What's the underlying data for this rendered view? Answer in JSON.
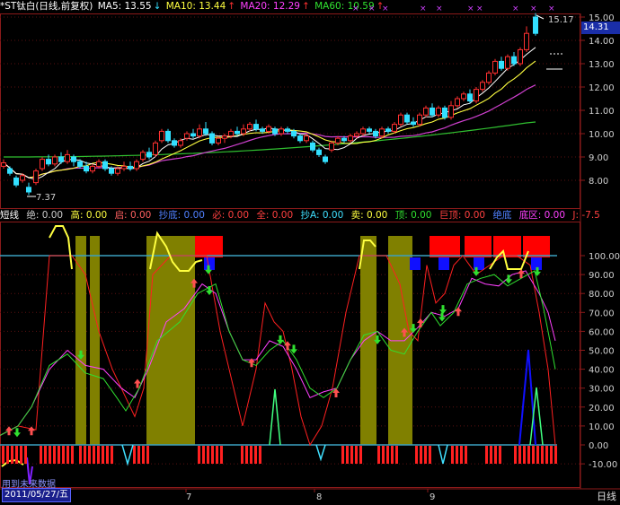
{
  "main_header": {
    "title": "*ST钛白(日线,前复权)",
    "ma5_label": "MA5: 13.55",
    "ma5_arrow": "↓",
    "ma10_label": "MA10: 13.44",
    "ma10_arrow": "↑",
    "ma20_label": "MA20: 12.29",
    "ma20_arrow": "↑",
    "ma60_label": "MA60: 10.59",
    "ma60_arrow": "↑"
  },
  "indicator_header": {
    "name": "短线",
    "items": [
      "绝: 0.00",
      "高: 0.00",
      "启: 0.00",
      "抄底: 0.00",
      "必: 0.00",
      "全: 0.00",
      "抄A: 0.00",
      "卖: 0.00",
      "顶: 0.00",
      "巨顶: 0.00",
      "绝底",
      "底区: 0.00",
      "J: -7.5"
    ]
  },
  "price_axis": [
    "15.00",
    "14.00",
    "13.00",
    "12.00",
    "11.00",
    "10.00",
    "9.00",
    "8.00"
  ],
  "current_price": "14.31",
  "high_marker": "15.17",
  "low_marker": "7.37",
  "indicator_axis": [
    "100.00",
    "90.00",
    "80.00",
    "70.00",
    "60.00",
    "50.00",
    "40.00",
    "30.00",
    "20.00",
    "10.00",
    "0.00",
    "-10.00"
  ],
  "date_axis": [
    "20",
    "7",
    "8",
    "9"
  ],
  "selected_date": "2011/05/27/五",
  "no_data_text": "用到未来数据",
  "period_tab": "日线",
  "colors": {
    "up": "#ff3030",
    "down": "#33e0ff",
    "ma5": "#ffffff",
    "ma10": "#ffff40",
    "ma20": "#ff40ff",
    "ma60": "#30e030"
  }
}
